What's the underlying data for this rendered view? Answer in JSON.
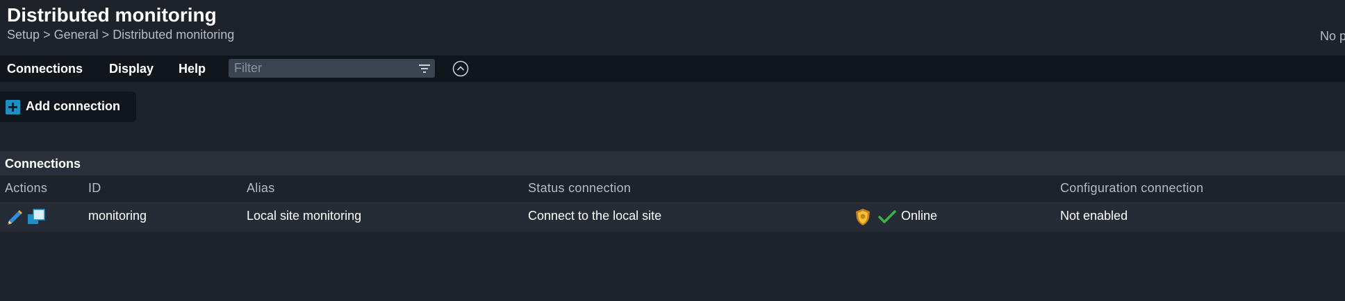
{
  "header": {
    "title": "Distributed monitoring",
    "breadcrumb": [
      "Setup",
      "General",
      "Distributed monitoring"
    ],
    "breadcrumb_sep": ">",
    "right_note": "No p"
  },
  "menubar": {
    "items": [
      "Connections",
      "Display",
      "Help"
    ],
    "filter_placeholder": "Filter",
    "filter_value": "",
    "filter_icon": "filter-icon",
    "collapse_icon": "chevron-up-circle-icon"
  },
  "toolbar": {
    "add_label": "Add connection",
    "add_icon": "plus-icon"
  },
  "table": {
    "section_title": "Connections",
    "columns": [
      "Actions",
      "ID",
      "Alias",
      "Status connection",
      "",
      "Configuration connection"
    ],
    "rows": [
      {
        "actions": [
          "edit-icon",
          "clone-icon"
        ],
        "id": "monitoring",
        "alias": "Local site monitoring",
        "status_connection": "Connect to the local site",
        "status_icons": [
          "shield-icon",
          "check-icon"
        ],
        "status": "Online",
        "configuration_connection": "Not enabled"
      }
    ]
  },
  "colors": {
    "background": "#1e2229",
    "menubar": "#11161d",
    "section_header": "#29303a",
    "row": "#262c35",
    "accent_blue": "#1f8fc3",
    "ok_green": "#3bb44a",
    "muted_text": "#b7bcc4"
  }
}
